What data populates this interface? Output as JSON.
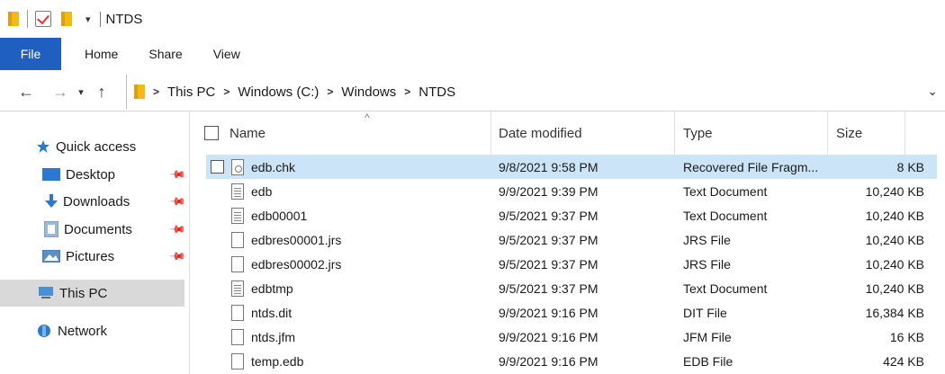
{
  "window": {
    "title": "NTDS",
    "qat_dropdown": "▾"
  },
  "ribbon": {
    "tabs": [
      {
        "label": "File",
        "active": true
      },
      {
        "label": "Home"
      },
      {
        "label": "Share"
      },
      {
        "label": "View"
      }
    ]
  },
  "address": {
    "crumbs": [
      "This PC",
      "Windows (C:)",
      "Windows",
      "NTDS"
    ],
    "separator": ">"
  },
  "nav": {
    "items": [
      {
        "label": "Quick access",
        "icon": "star-icon"
      },
      {
        "label": "Desktop",
        "icon": "desktop-icon",
        "pinned": true
      },
      {
        "label": "Downloads",
        "icon": "download-arrow-icon",
        "pinned": true
      },
      {
        "label": "Documents",
        "icon": "documents-icon",
        "pinned": true
      },
      {
        "label": "Pictures",
        "icon": "pictures-icon",
        "pinned": true
      },
      {
        "label": "This PC",
        "icon": "computer-icon",
        "selected": true
      },
      {
        "label": "Network",
        "icon": "network-icon"
      }
    ]
  },
  "columns": {
    "name": "Name",
    "date": "Date modified",
    "type": "Type",
    "size": "Size"
  },
  "files": [
    {
      "name": "edb.chk",
      "date": "9/8/2021 9:58 PM",
      "type": "Recovered File Fragm...",
      "size": "8 KB",
      "selected": true,
      "icon": "gear"
    },
    {
      "name": "edb",
      "date": "9/9/2021 9:39 PM",
      "type": "Text Document",
      "size": "10,240 KB",
      "icon": "lined"
    },
    {
      "name": "edb00001",
      "date": "9/5/2021 9:37 PM",
      "type": "Text Document",
      "size": "10,240 KB",
      "icon": "lined"
    },
    {
      "name": "edbres00001.jrs",
      "date": "9/5/2021 9:37 PM",
      "type": "JRS File",
      "size": "10,240 KB",
      "icon": "blank"
    },
    {
      "name": "edbres00002.jrs",
      "date": "9/5/2021 9:37 PM",
      "type": "JRS File",
      "size": "10,240 KB",
      "icon": "blank"
    },
    {
      "name": "edbtmp",
      "date": "9/5/2021 9:37 PM",
      "type": "Text Document",
      "size": "10,240 KB",
      "icon": "lined"
    },
    {
      "name": "ntds.dit",
      "date": "9/9/2021 9:16 PM",
      "type": "DIT File",
      "size": "16,384 KB",
      "icon": "blank"
    },
    {
      "name": "ntds.jfm",
      "date": "9/9/2021 9:16 PM",
      "type": "JFM File",
      "size": "16 KB",
      "icon": "blank"
    },
    {
      "name": "temp.edb",
      "date": "9/9/2021 9:16 PM",
      "type": "EDB File",
      "size": "424 KB",
      "icon": "blank"
    }
  ],
  "colors": {
    "accent": "#1f5fbf",
    "selection": "#cce4f7",
    "folder": "#f3b915"
  }
}
